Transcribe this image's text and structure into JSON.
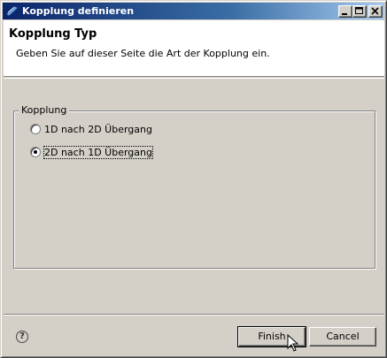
{
  "window": {
    "title": "Kopplung definieren",
    "icons": {
      "app": "eclipse-app-icon",
      "minimize": "minimize-icon",
      "maximize": "maximize-icon",
      "close": "close-icon"
    }
  },
  "page": {
    "title": "Kopplung Typ",
    "description": "Geben Sie auf dieser Seite die Art der Kopplung ein."
  },
  "group": {
    "label": "Kopplung",
    "options": [
      {
        "label": "1D nach 2D Übergang",
        "selected": false
      },
      {
        "label": "2D nach 1D Übergang",
        "selected": true
      }
    ]
  },
  "footer": {
    "help_icon": "help-icon",
    "help_glyph": "?",
    "finish_label": "Finish",
    "cancel_label": "Cancel"
  },
  "colors": {
    "titlebar_start": "#0a246a",
    "titlebar_end": "#a6caf0",
    "face": "#d4d0c8",
    "banner": "#ffffff"
  }
}
